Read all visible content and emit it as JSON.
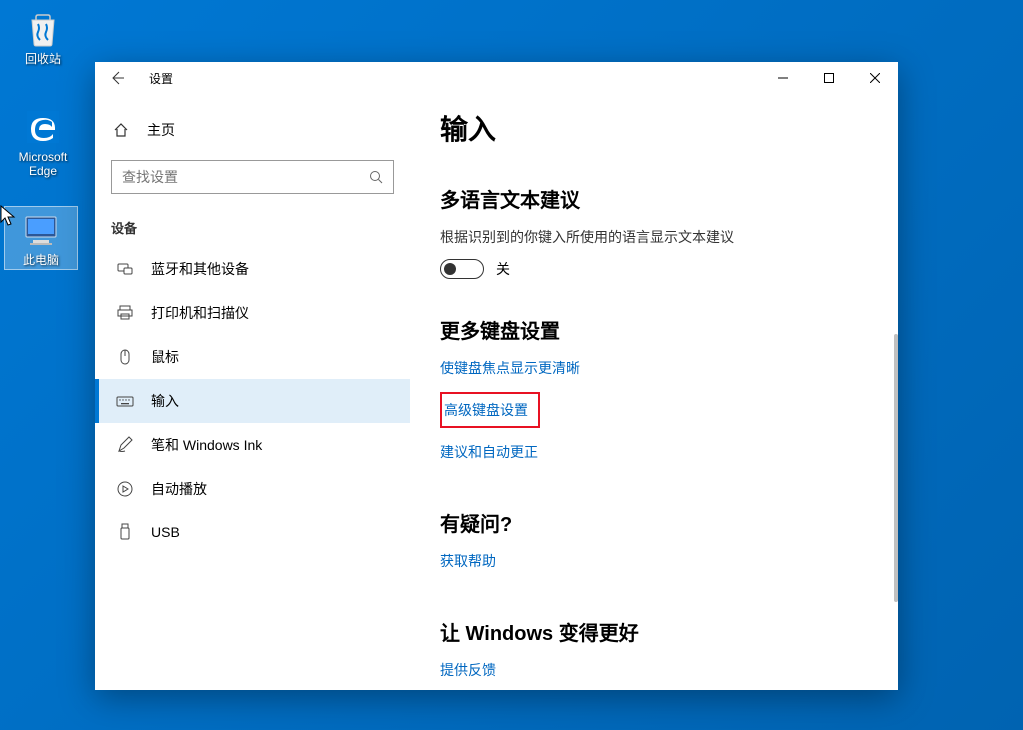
{
  "desktop": {
    "icons": [
      {
        "label": "回收站"
      },
      {
        "label": "Microsoft Edge"
      },
      {
        "label": "此电脑"
      }
    ]
  },
  "window": {
    "title": "设置",
    "home_label": "主页",
    "search_placeholder": "查找设置",
    "section_label": "设备",
    "nav": [
      {
        "label": "蓝牙和其他设备"
      },
      {
        "label": "打印机和扫描仪"
      },
      {
        "label": "鼠标"
      },
      {
        "label": "输入"
      },
      {
        "label": "笔和 Windows Ink"
      },
      {
        "label": "自动播放"
      },
      {
        "label": "USB"
      }
    ]
  },
  "content": {
    "page_title": "输入",
    "sect1_title": "多语言文本建议",
    "sect1_desc": "根据识别到的你键入所使用的语言显示文本建议",
    "toggle_state": "关",
    "sect2_title": "更多键盘设置",
    "link_focus": "使键盘焦点显示更清晰",
    "link_advanced": "高级键盘设置",
    "link_corrections": "建议和自动更正",
    "sect3_title": "有疑问?",
    "link_help": "获取帮助",
    "sect4_title": "让 Windows 变得更好",
    "link_feedback": "提供反馈"
  }
}
